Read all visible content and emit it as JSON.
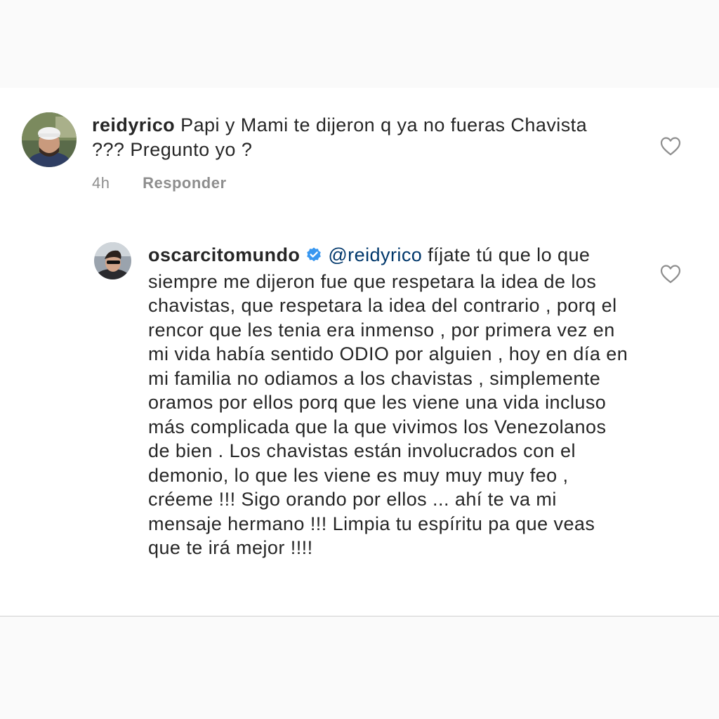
{
  "comments": [
    {
      "username": "reidyrico",
      "text": "Papi y Mami te dijeron q ya no fueras Chavista ??? Pregunto yo ?",
      "time": "4h",
      "reply_label": "Responder",
      "avatar_icon": "profile-photo"
    },
    {
      "username": "oscarcitomundo",
      "verified": true,
      "mention": "@reidyrico",
      "text": "fíjate tú que lo que siempre me dijeron fue que respetara la idea de los chavistas, que respetara la idea del contrario , porq el rencor que les tenia era inmenso , por primera vez en mi vida había sentido ODIO por alguien , hoy en día en mi familia no odiamos a los chavistas , simplemente oramos por ellos porq que les viene una vida incluso más complicada que la que vivimos  los Venezolanos de bien . Los chavistas están involucrados con el demonio, lo que les viene es muy muy muy feo , créeme !!! Sigo orando por ellos ... ahí te va mi mensaje hermano !!! Limpia tu espíritu pa que veas que te irá mejor !!!!",
      "avatar_icon": "profile-photo"
    }
  ],
  "colors": {
    "text": "#262626",
    "muted": "#8e8e8e",
    "mention": "#00376b",
    "verified": "#3897f0"
  },
  "icons": {
    "like": "heart-outline-icon",
    "verified": "verified-badge-icon"
  }
}
